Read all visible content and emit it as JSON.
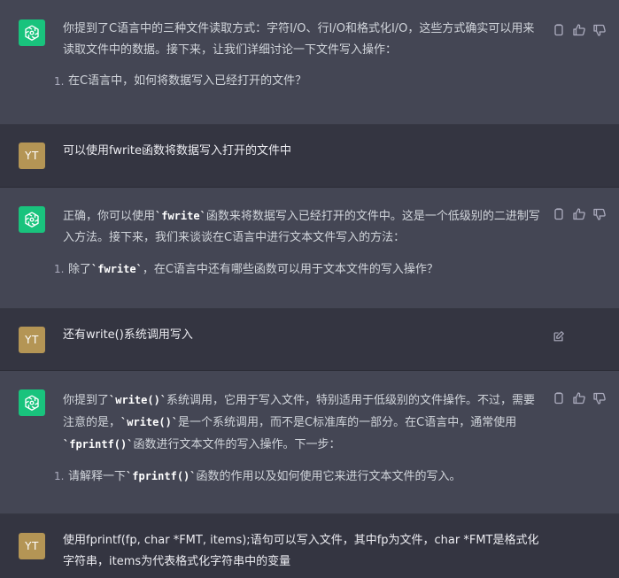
{
  "user_initials": "YT",
  "messages": [
    {
      "role": "assistant",
      "paragraph": [
        {
          "t": "text",
          "v": "你提到了C语言中的三种文件读取方式：字符I/O、行I/O和格式化I/O，这些方式确实可以用来读取文件中的数据。接下来，让我们详细讨论一下文件写入操作："
        }
      ],
      "list": [
        [
          {
            "t": "text",
            "v": "在C语言中，如何将数据写入已经打开的文件？"
          }
        ]
      ]
    },
    {
      "role": "user",
      "text": "可以使用fwrite函数将数据写入打开的文件中"
    },
    {
      "role": "assistant",
      "paragraph": [
        {
          "t": "text",
          "v": "正确，你可以使用"
        },
        {
          "t": "code",
          "v": "`fwrite`"
        },
        {
          "t": "text",
          "v": "函数来将数据写入已经打开的文件中。这是一个低级别的二进制写入方法。接下来，我们来谈谈在C语言中进行文本文件写入的方法："
        }
      ],
      "list": [
        [
          {
            "t": "text",
            "v": "除了"
          },
          {
            "t": "code",
            "v": "`fwrite`"
          },
          {
            "t": "text",
            "v": "，在C语言中还有哪些函数可以用于文本文件的写入操作？"
          }
        ]
      ]
    },
    {
      "role": "user",
      "text": "还有write()系统调用写入"
    },
    {
      "role": "assistant",
      "paragraph": [
        {
          "t": "text",
          "v": "你提到了"
        },
        {
          "t": "code",
          "v": "`write()`"
        },
        {
          "t": "text",
          "v": "系统调用，它用于写入文件，特别适用于低级别的文件操作。不过，需要注意的是，"
        },
        {
          "t": "code",
          "v": "`write()`"
        },
        {
          "t": "text",
          "v": "是一个系统调用，而不是C标准库的一部分。在C语言中，通常使用"
        },
        {
          "t": "code",
          "v": "`fprintf()`"
        },
        {
          "t": "text",
          "v": "函数进行文本文件的写入操作。下一步："
        }
      ],
      "list": [
        [
          {
            "t": "text",
            "v": "请解释一下"
          },
          {
            "t": "code",
            "v": "`fprintf()`"
          },
          {
            "t": "text",
            "v": "函数的作用以及如何使用它来进行文本文件的写入。"
          }
        ]
      ]
    },
    {
      "role": "user",
      "text": "使用fprintf(fp, char *FMT, items);语句可以写入文件，其中fp为文件，char *FMT是格式化字符串，items为代表格式化字符串中的变量"
    }
  ]
}
